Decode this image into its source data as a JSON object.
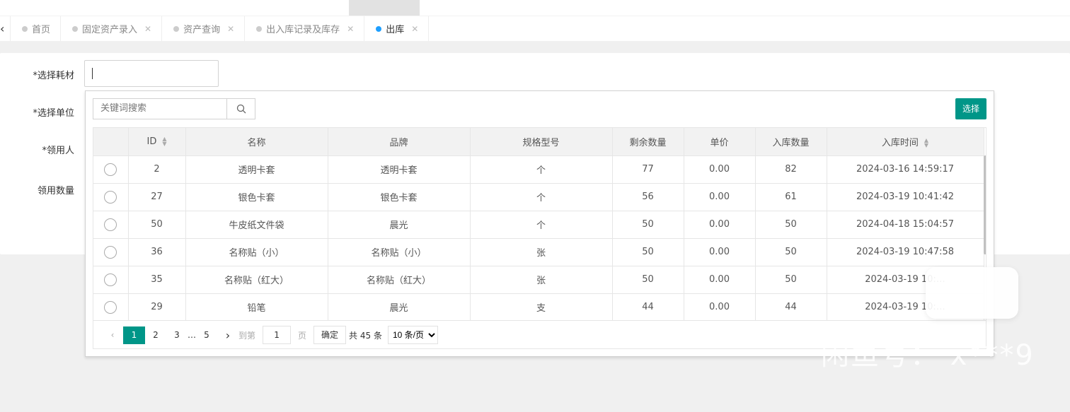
{
  "tabs": [
    {
      "label": "首页",
      "closable": false
    },
    {
      "label": "固定资产录入",
      "closable": true
    },
    {
      "label": "资产查询",
      "closable": true
    },
    {
      "label": "出入库记录及库存",
      "closable": true
    },
    {
      "label": "出库",
      "closable": true,
      "active": true
    }
  ],
  "form": {
    "material_label": "*选择耗材",
    "unit_label": "*选择单位",
    "receiver_label": "*领用人",
    "qty_label": "领用数量",
    "material_value": ""
  },
  "popup": {
    "search_placeholder": "关键词搜索",
    "select_label": "选择",
    "columns": [
      "ID",
      "名称",
      "品牌",
      "规格型号",
      "剩余数量",
      "单价",
      "入库数量",
      "入库时间"
    ],
    "rows": [
      [
        "2",
        "透明卡套",
        "透明卡套",
        "个",
        "77",
        "0.00",
        "82",
        "2024-03-16 14:59:17"
      ],
      [
        "27",
        "银色卡套",
        "银色卡套",
        "个",
        "56",
        "0.00",
        "61",
        "2024-03-19 10:41:42"
      ],
      [
        "50",
        "牛皮纸文件袋",
        "晨光",
        "个",
        "50",
        "0.00",
        "50",
        "2024-04-18 15:04:57"
      ],
      [
        "36",
        "名称贴（小）",
        "名称贴（小）",
        "张",
        "50",
        "0.00",
        "50",
        "2024-03-19 10:47:58"
      ],
      [
        "35",
        "名称贴（红大）",
        "名称贴（红大）",
        "张",
        "50",
        "0.00",
        "50",
        "2024-03-19 10:…"
      ],
      [
        "29",
        "铅笔",
        "晨光",
        "支",
        "44",
        "0.00",
        "44",
        "2024-03-19 10:…"
      ]
    ],
    "pager": {
      "pages": [
        "1",
        "2",
        "3",
        "…",
        "5"
      ],
      "goto_label": "到第",
      "goto_value": "1",
      "page_unit": "页",
      "confirm": "确定",
      "total": "共 45 条",
      "page_size": "10 条/页"
    }
  },
  "watermark": {
    "logo": "闲鱼",
    "text": "闲鱼号： x***9"
  },
  "colors": {
    "accent": "#009688",
    "active_dot": "#1e9fff"
  }
}
